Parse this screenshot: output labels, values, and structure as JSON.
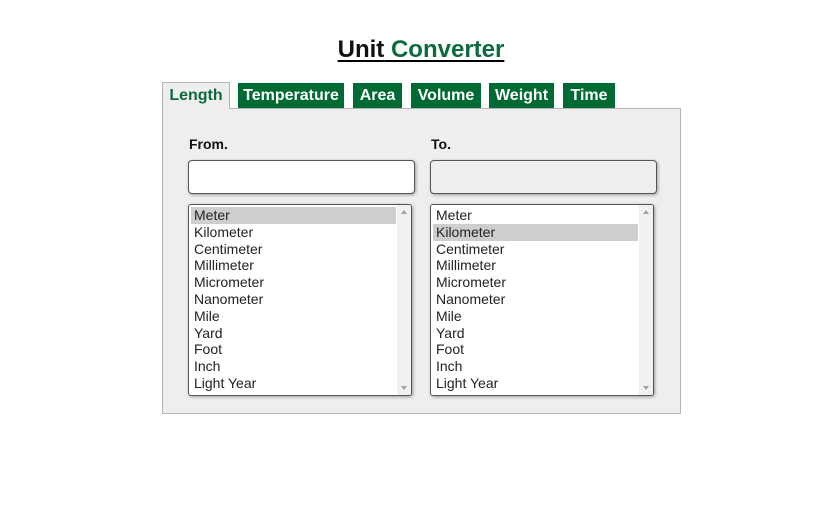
{
  "title": {
    "word1": "Unit",
    "word2": "Converter"
  },
  "colors": {
    "brand_green": "#006a35",
    "panel_bg": "#eeeeee",
    "selected_option": "#cecece"
  },
  "tabs": [
    {
      "label": "Length",
      "active": true
    },
    {
      "label": "Temperature",
      "active": false
    },
    {
      "label": "Area",
      "active": false
    },
    {
      "label": "Volume",
      "active": false
    },
    {
      "label": "Weight",
      "active": false
    },
    {
      "label": "Time",
      "active": false
    }
  ],
  "from": {
    "label": "From.",
    "value": "",
    "units": [
      "Meter",
      "Kilometer",
      "Centimeter",
      "Millimeter",
      "Micrometer",
      "Nanometer",
      "Mile",
      "Yard",
      "Foot",
      "Inch",
      "Light Year"
    ],
    "selected": "Meter"
  },
  "to": {
    "label": "To.",
    "value": "",
    "units": [
      "Meter",
      "Kilometer",
      "Centimeter",
      "Millimeter",
      "Micrometer",
      "Nanometer",
      "Mile",
      "Yard",
      "Foot",
      "Inch",
      "Light Year"
    ],
    "selected": "Kilometer"
  }
}
